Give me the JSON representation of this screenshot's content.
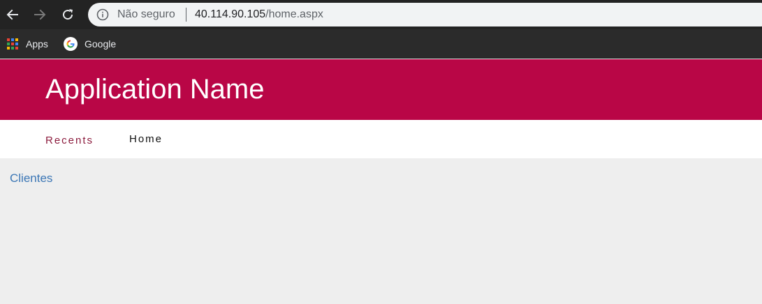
{
  "browser": {
    "back_icon": "arrow-left-icon",
    "forward_icon": "arrow-right-icon",
    "reload_icon": "reload-icon",
    "security_icon": "info-circle-icon",
    "security_label": "Não seguro",
    "url_host": "40.114.90.105",
    "url_path": "/home.aspx"
  },
  "bookmarks": [
    {
      "label": "Apps",
      "icon": "apps-grid-icon"
    },
    {
      "label": "Google",
      "icon": "google-logo-icon"
    }
  ],
  "header": {
    "title": "Application Name",
    "background_color": "#b90646"
  },
  "nav": {
    "items": [
      {
        "label": "Recents"
      },
      {
        "label": "Home"
      }
    ]
  },
  "content": {
    "link_label": "Clientes",
    "link_color": "#3b76b5"
  }
}
